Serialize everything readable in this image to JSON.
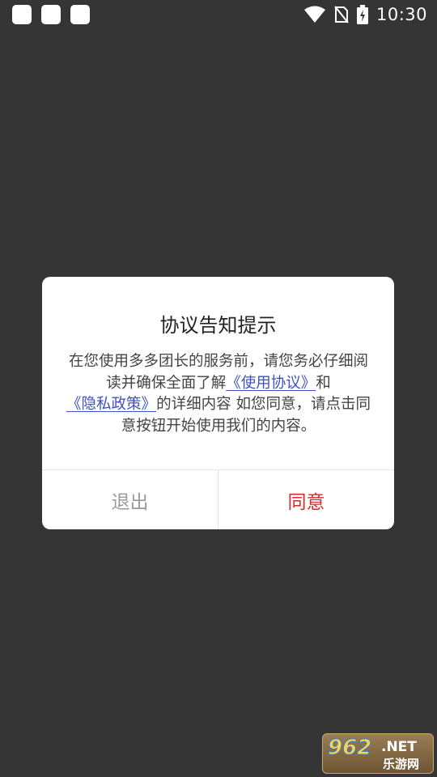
{
  "status_bar": {
    "time": "10:30",
    "icons": [
      "notification-square-icon",
      "notification-square-icon",
      "notification-square-icon",
      "wifi-icon",
      "no-sim-icon",
      "battery-charging-icon"
    ]
  },
  "dialog": {
    "title": "协议告知提示",
    "body": {
      "text_1": "在您使用多多团长的服务前，请您务必仔细阅读并确保全面了解",
      "link_terms": "《使用协议》",
      "text_2": "和",
      "link_privacy": "《隐私政策》",
      "text_3": "的详细内容 如您同意，请点击同意按钮开始使用我们的内容。"
    },
    "buttons": {
      "exit": "退出",
      "agree": "同意"
    }
  },
  "watermark": {
    "number": "962",
    "suffix": ".NET",
    "site_name": "乐游网"
  },
  "colors": {
    "background": "#353535",
    "link": "#3f51c4",
    "agree": "#d52b2b",
    "exit": "#9a9a9a"
  }
}
